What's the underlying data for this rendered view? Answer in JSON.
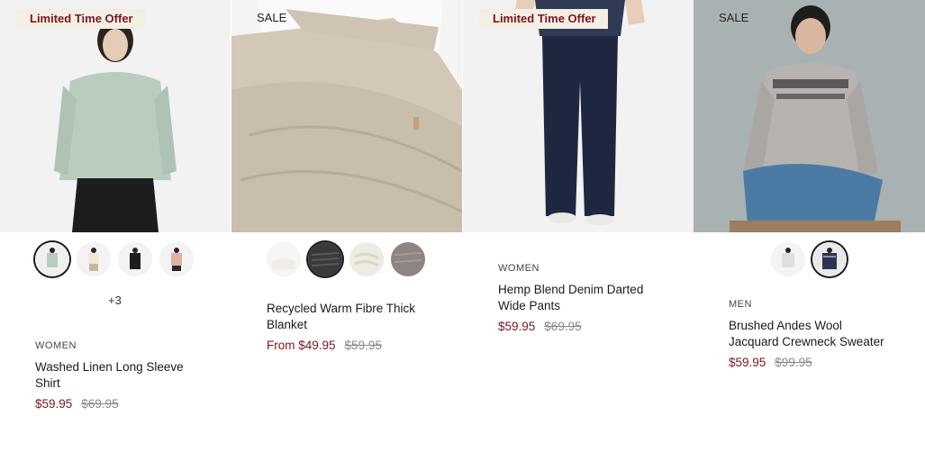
{
  "products": [
    {
      "badge": "Limited Time Offer",
      "swatches_more": "+3",
      "category": "WOMEN",
      "name_line1": "Washed Linen Long Sleeve",
      "name_line2": "Shirt",
      "price": "$59.95",
      "original_price": "$69.95"
    },
    {
      "badge": "SALE",
      "category": "",
      "name_line1": "Recycled Warm Fibre Thick",
      "name_line2": "Blanket",
      "price": "From $49.95",
      "original_price": "$59.95"
    },
    {
      "badge": "Limited Time Offer",
      "category": "WOMEN",
      "name_line1": "Hemp Blend Denim Darted",
      "name_line2": "Wide Pants",
      "price": "$59.95",
      "original_price": "$69.95"
    },
    {
      "badge": "SALE",
      "category": "MEN",
      "name_line1": "Brushed Andes Wool",
      "name_line2": "Jacquard Crewneck Sweater",
      "price": "$59.95",
      "original_price": "$99.95"
    }
  ],
  "colors": {
    "sale_price": "#7a1620",
    "badge_bg": "#f4efe5",
    "strike_price": "#888888"
  }
}
